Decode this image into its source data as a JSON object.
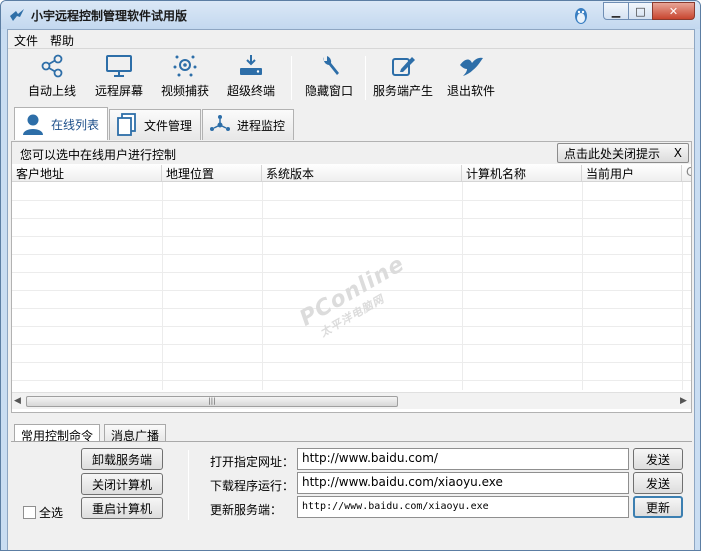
{
  "window": {
    "title": "小宇远程控制管理软件试用版",
    "controls": {
      "minimize": "▁",
      "maximize": "□",
      "close": "✕"
    }
  },
  "menu": [
    "文件",
    "帮助"
  ],
  "toolbar": [
    {
      "label": "自动上线",
      "icon": "share-nodes-icon"
    },
    {
      "label": "远程屏幕",
      "icon": "monitor-icon"
    },
    {
      "label": "视频捕获",
      "icon": "webcam-icon"
    },
    {
      "label": "超级终端",
      "icon": "terminal-download-icon"
    },
    {
      "label": "隐藏窗口",
      "icon": "wrench-icon"
    },
    {
      "label": "服务端产生",
      "icon": "edit-pen-icon"
    },
    {
      "label": "退出软件",
      "icon": "bird-icon"
    }
  ],
  "top_tabs": [
    {
      "label": "在线列表",
      "icon": "user-icon",
      "selected": true
    },
    {
      "label": "文件管理",
      "icon": "files-icon",
      "selected": false
    },
    {
      "label": "进程监控",
      "icon": "process-icon",
      "selected": false
    }
  ],
  "online_panel": {
    "hint": "您可以选中在线用户进行控制",
    "close_hint_button": "点击此处关闭提示",
    "close_hint_x": "X",
    "columns": [
      "客户地址",
      "地理位置",
      "系统版本",
      "计算机名称",
      "当前用户",
      "C"
    ],
    "scroll_grip": "|||",
    "scroll_left": "◀",
    "scroll_right": "▶"
  },
  "watermark": {
    "brand": "PConline",
    "sub": "太平洋电脑网"
  },
  "bottom_tabs": [
    {
      "label": "常用控制命令",
      "selected": true
    },
    {
      "label": "消息广播",
      "selected": false
    }
  ],
  "commands": {
    "uninstall": "卸载服务端",
    "shutdown": "关闭计算机",
    "restart": "重启计算机",
    "select_all": "全选",
    "open_url_label": "打开指定网址：",
    "open_url_value": "http://www.baidu.com/",
    "download_label": "下载程序运行：",
    "download_value": "http://www.baidu.com/xiaoyu.exe",
    "update_label": "更新服务端：",
    "update_value": "http://www.baidu.com/xiaoyu.exe",
    "send1": "发送",
    "send2": "发送",
    "update_btn": "更新"
  },
  "colors": {
    "accent": "#2d6ea8",
    "titlebar": "#c9ddf2",
    "close": "#c8452f"
  }
}
